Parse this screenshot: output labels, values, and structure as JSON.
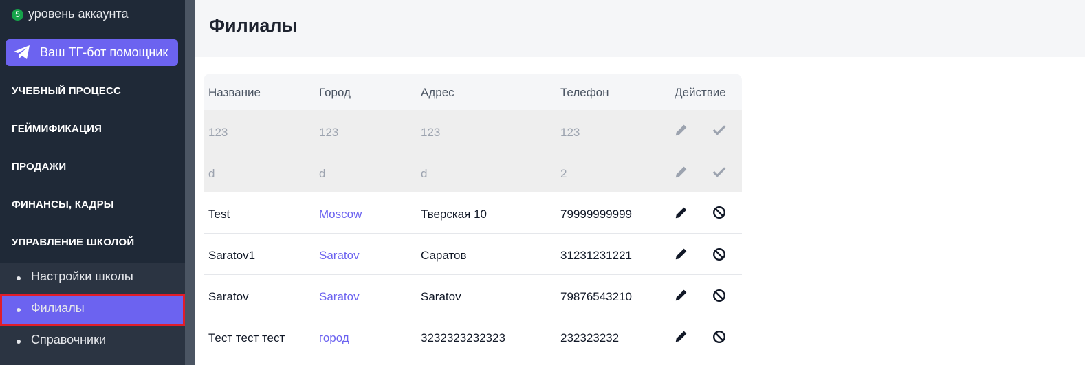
{
  "sidebar": {
    "account_level_badge": "5",
    "account_level_label": "уровень аккаунта",
    "tg_button_label": "Ваш ТГ-бот помощник",
    "sections": [
      {
        "label": "УЧЕБНЫЙ ПРОЦЕСС"
      },
      {
        "label": "ГЕЙМИФИКАЦИЯ"
      },
      {
        "label": "ПРОДАЖИ"
      },
      {
        "label": "ФИНАНСЫ, КАДРЫ"
      },
      {
        "label": "УПРАВЛЕНИЕ ШКОЛОЙ"
      }
    ],
    "sub_items": [
      {
        "label": "Настройки школы",
        "active": false
      },
      {
        "label": "Филиалы",
        "active": true
      },
      {
        "label": "Справочники",
        "active": false
      }
    ]
  },
  "page": {
    "title": "Филиалы"
  },
  "table": {
    "headers": {
      "name": "Название",
      "city": "Город",
      "address": "Адрес",
      "phone": "Телефон",
      "action": "Действие"
    },
    "draft_rows": [
      {
        "name": "123",
        "city": "123",
        "address": "123",
        "phone": "123"
      },
      {
        "name": "d",
        "city": "d",
        "address": "d",
        "phone": "2"
      }
    ],
    "rows": [
      {
        "name": "Test",
        "city": "Moscow",
        "address": "Тверская 10",
        "phone": "79999999999"
      },
      {
        "name": "Saratov1",
        "city": "Saratov",
        "address": "Саратов",
        "phone": "31231231221"
      },
      {
        "name": "Saratov",
        "city": "Saratov",
        "address": "Saratov",
        "phone": "79876543210"
      },
      {
        "name": "Тест тест тест",
        "city": "город",
        "address": "3232323232323",
        "phone": "232323232"
      }
    ]
  },
  "colors": {
    "accent": "#6c63f0",
    "sidebar_bg": "#1f2937",
    "active_outline": "#e11d2a",
    "account_badge": "#16a34a"
  }
}
